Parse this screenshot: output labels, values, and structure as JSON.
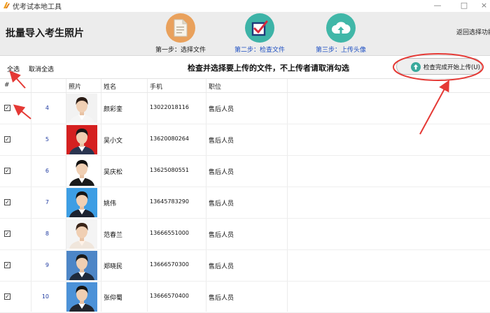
{
  "window": {
    "title": "优考试本地工具",
    "minimize": "—",
    "maximize": "□",
    "close": "×"
  },
  "header": {
    "title": "批量导入考生照片",
    "steps": [
      {
        "label": "第一步：选择文件",
        "icon": "document-icon"
      },
      {
        "label": "第二步：检查文件",
        "icon": "checkbox-icon"
      },
      {
        "label": "第三步：上传头像",
        "icon": "cloud-upload-icon"
      }
    ],
    "return_link": "返回选择功能"
  },
  "toolbar": {
    "select_all": "全选",
    "deselect_all": "取消全选",
    "instruction": "检查并选择要上传的文件，不上传者请取消勾选",
    "upload_button": "检查完成开始上传(U)"
  },
  "table": {
    "columns": [
      "#",
      "照片",
      "姓名",
      "手机",
      "职位"
    ],
    "rows": [
      {
        "checked": true,
        "num": "4",
        "name": "颜彩銮",
        "phone": "13022018116",
        "position": "售后人员",
        "bg": "#f2f2f2",
        "hair": "#2a1b14",
        "shirt": "#ffffff",
        "suit": "#f5f5f5"
      },
      {
        "checked": true,
        "num": "5",
        "name": "吴小文",
        "phone": "13620080264",
        "position": "售后人员",
        "bg": "#d52020",
        "hair": "#1a1a1a",
        "shirt": "#ffffff",
        "suit": "#2a3550"
      },
      {
        "checked": true,
        "num": "6",
        "name": "吴庆松",
        "phone": "13625080551",
        "position": "售后人员",
        "bg": "#ffffff",
        "hair": "#111111",
        "shirt": "#ffffff",
        "suit": "#1a1a1a"
      },
      {
        "checked": true,
        "num": "7",
        "name": "姚伟",
        "phone": "13645783290",
        "position": "售后人员",
        "bg": "#3d9ee4",
        "hair": "#151515",
        "shirt": "#ffffff",
        "suit": "#1c2230"
      },
      {
        "checked": true,
        "num": "8",
        "name": "范春兰",
        "phone": "13666551000",
        "position": "售后人员",
        "bg": "#f4f4f4",
        "hair": "#3a2418",
        "shirt": "#fff2e8",
        "suit": "#f0e6dc"
      },
      {
        "checked": true,
        "num": "9",
        "name": "郑晓民",
        "phone": "13666570300",
        "position": "售后人员",
        "bg": "#4d86c7",
        "hair": "#1a1a1a",
        "shirt": "#ffffff",
        "suit": "#1f2a3c"
      },
      {
        "checked": true,
        "num": "10",
        "name": "张仰蜀",
        "phone": "13666570400",
        "position": "售后人员",
        "bg": "#4c92d8",
        "hair": "#151515",
        "shirt": "#ffffff",
        "suit": "#22262e"
      }
    ]
  },
  "colors": {
    "annotation": "#e53935",
    "step_link": "#1e4fc2"
  }
}
